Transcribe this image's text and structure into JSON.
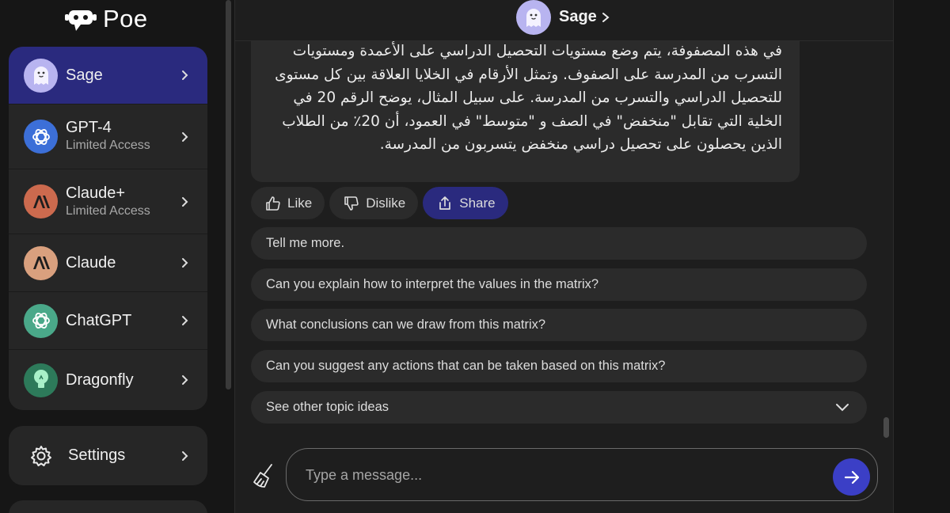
{
  "app": {
    "name": "Poe"
  },
  "sidebar": {
    "bots": [
      {
        "name": "Sage",
        "subtitle": "",
        "icon": "sage-ghost-icon",
        "active": true
      },
      {
        "name": "GPT-4",
        "subtitle": "Limited Access",
        "icon": "openai-icon"
      },
      {
        "name": "Claude+",
        "subtitle": "Limited Access",
        "icon": "anthropic-icon"
      },
      {
        "name": "Claude",
        "subtitle": "",
        "icon": "anthropic-icon"
      },
      {
        "name": "ChatGPT",
        "subtitle": "",
        "icon": "openai-icon"
      },
      {
        "name": "Dragonfly",
        "subtitle": "",
        "icon": "lightbulb-icon"
      }
    ],
    "settings_label": "Settings"
  },
  "header": {
    "title": "Sage"
  },
  "message": {
    "text": "في هذه المصفوفة، يتم وضع مستويات التحصيل الدراسي على الأعمدة ومستويات التسرب من المدرسة على الصفوف. وتمثل الأرقام في الخلايا العلاقة بين كل مستوى للتحصيل الدراسي والتسرب من المدرسة. على سبيل المثال، يوضح الرقم 20 في الخلية التي تقابل \"منخفض\" في الصف و \"متوسط\" في العمود، أن 20٪ من الطلاب الذين يحصلون على تحصيل دراسي منخفض يتسربون من المدرسة."
  },
  "actions": {
    "like": "Like",
    "dislike": "Dislike",
    "share": "Share"
  },
  "suggestions": [
    "Tell me more.",
    "Can you explain how to interpret the values in the matrix?",
    "What conclusions can we draw from this matrix?",
    "Can you suggest any actions that can be taken based on this matrix?"
  ],
  "other_topics_label": "See other topic ideas",
  "composer": {
    "placeholder": "Type a message..."
  },
  "colors": {
    "accent": "#3b3fc6",
    "active_item": "#2a2a7e",
    "sage_avatar": "#b8b4f0"
  }
}
